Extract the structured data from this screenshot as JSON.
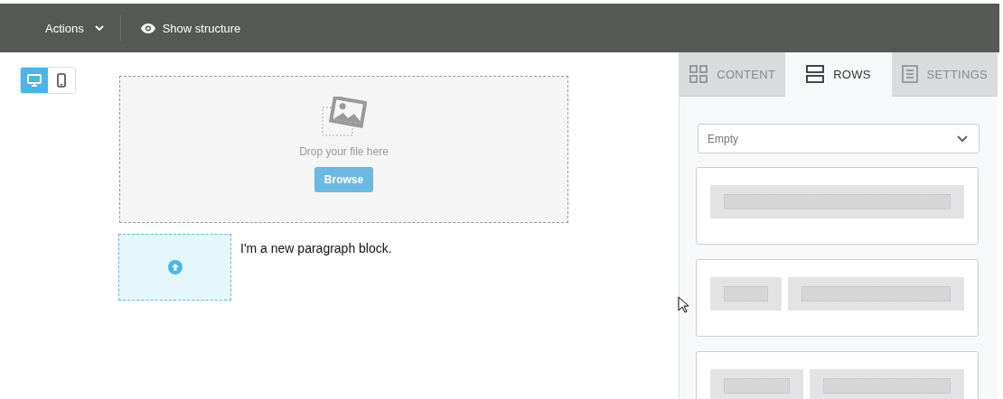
{
  "toolbar": {
    "actions": "Actions",
    "show_structure": "Show structure"
  },
  "devices": [
    {
      "kind": "desktop",
      "selected": true
    },
    {
      "kind": "mobile",
      "selected": false
    }
  ],
  "image_block": {
    "hint": "Drop your file here",
    "button": "Browse"
  },
  "paragraph": "I'm a new paragraph block.",
  "tabs": [
    {
      "kind": "content",
      "label": "CONTENT",
      "selected": false
    },
    {
      "kind": "rows",
      "label": "ROWS",
      "selected": true
    },
    {
      "kind": "settings",
      "label": "SETTINGS",
      "selected": false
    }
  ],
  "row_filter": {
    "value": "Empty"
  },
  "row_layouts": [
    {
      "kind": "single"
    },
    {
      "kind": "quarter-left"
    },
    {
      "kind": "third-left"
    }
  ]
}
